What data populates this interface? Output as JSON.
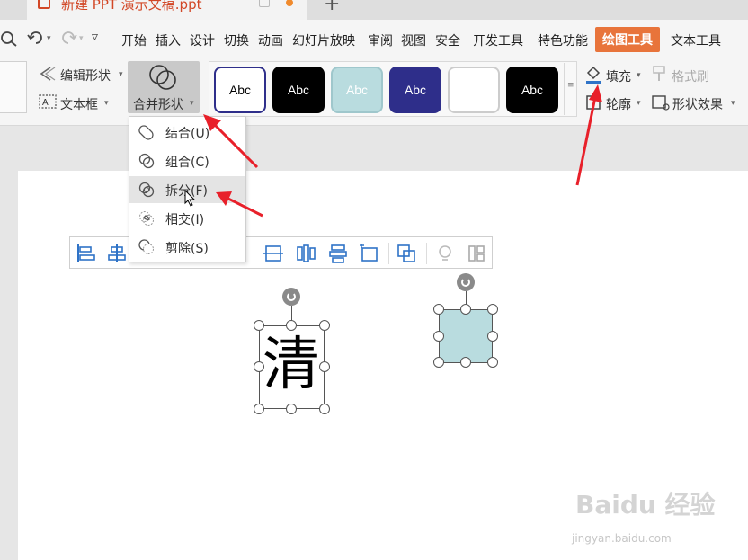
{
  "title_bar": {
    "doc_title": "新建 PPT 演示文稿.ppt"
  },
  "menu": {
    "items": [
      "开始",
      "插入",
      "设计",
      "切换",
      "动画",
      "幻灯片放映",
      "审阅",
      "视图",
      "安全",
      "开发工具",
      "特色功能",
      "绘图工具",
      "文本工具"
    ],
    "active": "绘图工具"
  },
  "ribbon": {
    "edit_shape": "编辑形状",
    "text_box": "文本框",
    "merge_shapes": "合并形状",
    "fill": "填充",
    "format_painter": "格式刷",
    "outline": "轮廓",
    "shape_effects": "形状效果",
    "style_gallery": [
      {
        "label": "Abc",
        "bg": "#ffffff",
        "fg": "#000000",
        "border": "#2e2e8a"
      },
      {
        "label": "Abc",
        "bg": "#000000",
        "fg": "#ffffff",
        "border": "#000000"
      },
      {
        "label": "Abc",
        "bg": "#b9dcdf",
        "fg": "#ffffff",
        "border": "#9fc7cc"
      },
      {
        "label": "Abc",
        "bg": "#2e2e8a",
        "fg": "#ffffff",
        "border": "#2e2e8a"
      },
      {
        "label": "",
        "bg": "#ffffff",
        "fg": "#000000",
        "border": "#cccccc"
      },
      {
        "label": "Abc",
        "bg": "#000000",
        "fg": "#ffffff",
        "border": "#000000"
      }
    ]
  },
  "merge_dropdown": {
    "items": [
      {
        "label": "结合(U)",
        "icon": "union-icon"
      },
      {
        "label": "组合(C)",
        "icon": "combine-icon"
      },
      {
        "label": "拆分(F)",
        "icon": "fragment-icon",
        "hover": true
      },
      {
        "label": "相交(I)",
        "icon": "intersect-icon"
      },
      {
        "label": "剪除(S)",
        "icon": "subtract-icon"
      }
    ]
  },
  "slide": {
    "char_shape_text": "清",
    "rect_color": "#b9dcdf"
  },
  "watermark": {
    "brand": "Baidu 经验",
    "url": "jingyan.baidu.com"
  },
  "colors": {
    "accent": "#e8743b",
    "arrow": "#e8202a",
    "icon_blue": "#2f73c7"
  }
}
